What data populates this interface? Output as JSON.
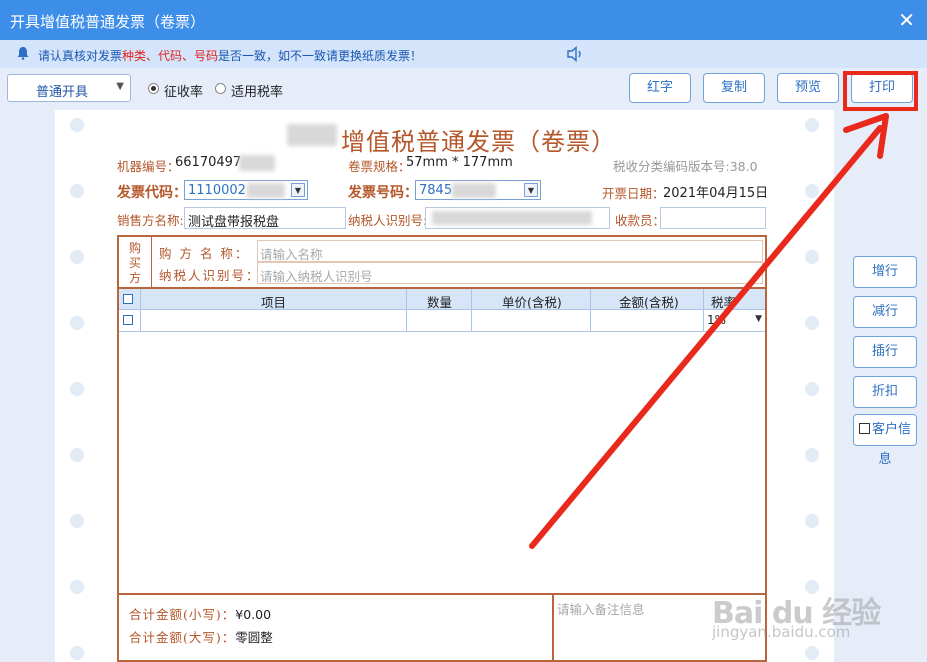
{
  "window": {
    "title": "开具增值税普通发票（卷票）"
  },
  "notice": {
    "prefix": "请认真核对发票",
    "highlight": "种类、代码、号码",
    "suffix": "是否一致，如不一致请更换纸质发票！"
  },
  "toolbar": {
    "mode": "普通开具",
    "radio_collect": "征收率",
    "radio_apply": "适用税率",
    "btn_red": "红字",
    "btn_copy": "复制",
    "btn_preview": "预览",
    "btn_print": "打印"
  },
  "side_buttons": {
    "add_row": "增行",
    "remove_row": "减行",
    "insert_row": "插行",
    "discount": "折扣",
    "customer_info": "客户信息"
  },
  "invoice": {
    "title": "增值税普通发票（卷票）",
    "machine_label": "机器编号：",
    "machine_value": "66170497",
    "spec_label": "卷票规格：",
    "spec_value": "57mm * 177mm",
    "tax_version": "税收分类编码版本号:38.0",
    "code_label": "发票代码：",
    "code_value": "1110002",
    "number_label": "发票号码：",
    "number_value": "7845",
    "date_label": "开票日期：",
    "date_value": "2021年04月15日",
    "seller_label": "销售方名称:",
    "seller_value": "测试盘带报税盘",
    "taxpayer_label": "纳税人识别号:",
    "cashier_label": "收款员：",
    "buyer_side": [
      "购",
      "买",
      "方"
    ],
    "buyer_name_label": "购 方 名 称：",
    "buyer_name_placeholder": "请输入名称",
    "buyer_tax_label": "纳税人识别号：",
    "buyer_tax_placeholder": "请输入纳税人识别号",
    "columns": [
      "项目",
      "数量",
      "单价(含税)",
      "金额(含税)",
      "税率"
    ],
    "rate_value": "1%",
    "total_small_label": "合计金额(小写)：",
    "total_small_value": "¥0.00",
    "total_big_label": "合计金额(大写)：",
    "total_big_value": "零圆整",
    "remark_placeholder": "请输入备注信息"
  },
  "watermark": {
    "brand": "Bai du 经验",
    "url": "jingyan.baidu.com"
  },
  "colors": {
    "accent": "#3d8ee8",
    "invoice_brown": "#b4572a",
    "highlight": "#e8291c"
  }
}
